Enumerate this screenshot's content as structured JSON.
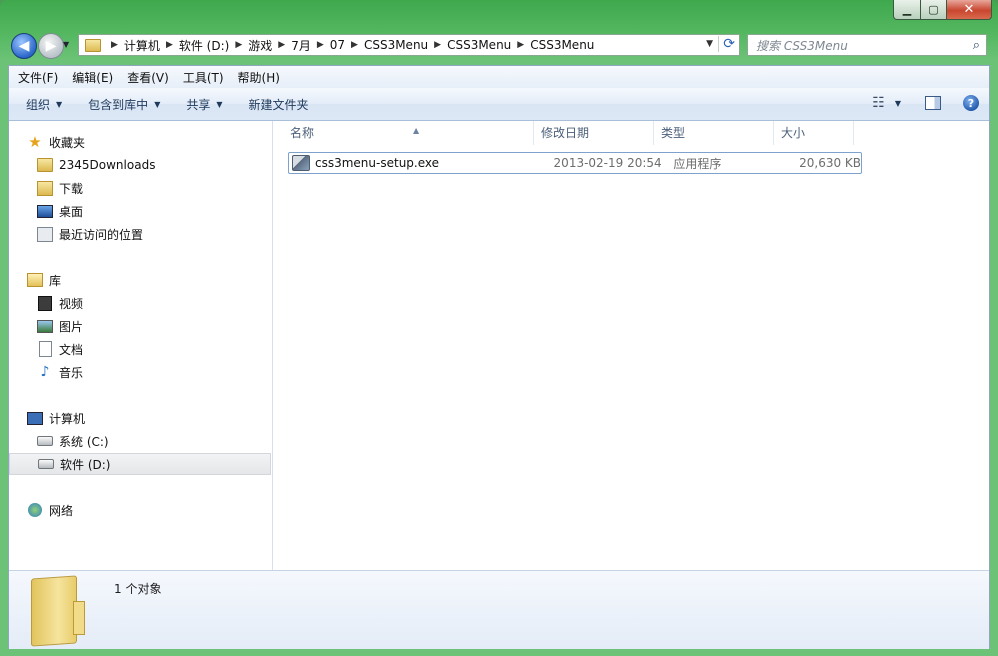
{
  "window": {
    "caption_min": "▁",
    "caption_max": "▢",
    "caption_close": "✕"
  },
  "nav": {
    "back": "◀",
    "forward": "▶",
    "breadcrumb": [
      "计算机",
      "软件 (D:)",
      "游戏",
      "7月",
      "07",
      "CSS3Menu",
      "CSS3Menu",
      "CSS3Menu"
    ],
    "search_placeholder": "搜索 CSS3Menu"
  },
  "menubar": [
    "文件(F)",
    "编辑(E)",
    "查看(V)",
    "工具(T)",
    "帮助(H)"
  ],
  "toolbar": {
    "organize": "组织",
    "include_library": "包含到库中",
    "share": "共享",
    "new_folder": "新建文件夹"
  },
  "sidebar": {
    "favorites": {
      "label": "收藏夹",
      "items": [
        "2345Downloads",
        "下载",
        "桌面",
        "最近访问的位置"
      ]
    },
    "libraries": {
      "label": "库",
      "items": [
        "视频",
        "图片",
        "文档",
        "音乐"
      ]
    },
    "computer": {
      "label": "计算机",
      "items": [
        "系统 (C:)",
        "软件 (D:)"
      ],
      "selected": "软件 (D:)"
    },
    "network": {
      "label": "网络"
    }
  },
  "list": {
    "columns": [
      "名称",
      "修改日期",
      "类型",
      "大小"
    ],
    "files": [
      {
        "name": "css3menu-setup.exe",
        "modified": "2013-02-19 20:54",
        "type": "应用程序",
        "size": "20,630 KB"
      }
    ]
  },
  "details": {
    "count": "1 个对象"
  },
  "colors": {
    "frame": "#55b861",
    "selection_border": "#7da2ce",
    "toolbar_text": "#1e395b"
  }
}
